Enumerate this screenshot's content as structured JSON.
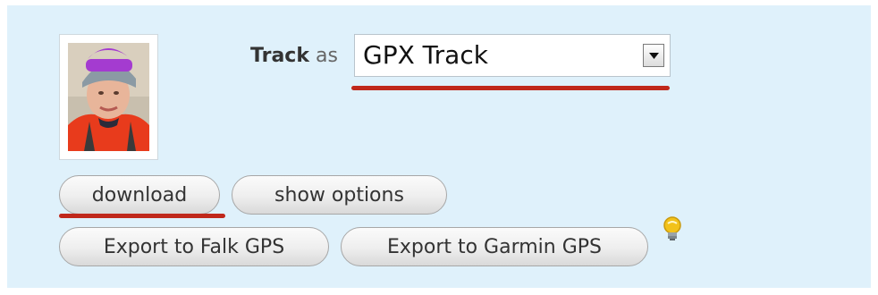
{
  "avatar": {
    "alt": "User avatar"
  },
  "track": {
    "label_bold": "Track",
    "label_as": "as",
    "selected": "GPX Track"
  },
  "buttons": {
    "download": "download",
    "show_options": "show options",
    "export_falk": "Export to Falk GPS",
    "export_garmin": "Export to Garmin GPS"
  },
  "colors": {
    "panel_bg": "#dff1fb",
    "underline": "#c0281b",
    "bulb": "#f2c21a"
  },
  "icons": {
    "tip": "lightbulb-icon",
    "dropdown": "chevron-down-icon"
  }
}
